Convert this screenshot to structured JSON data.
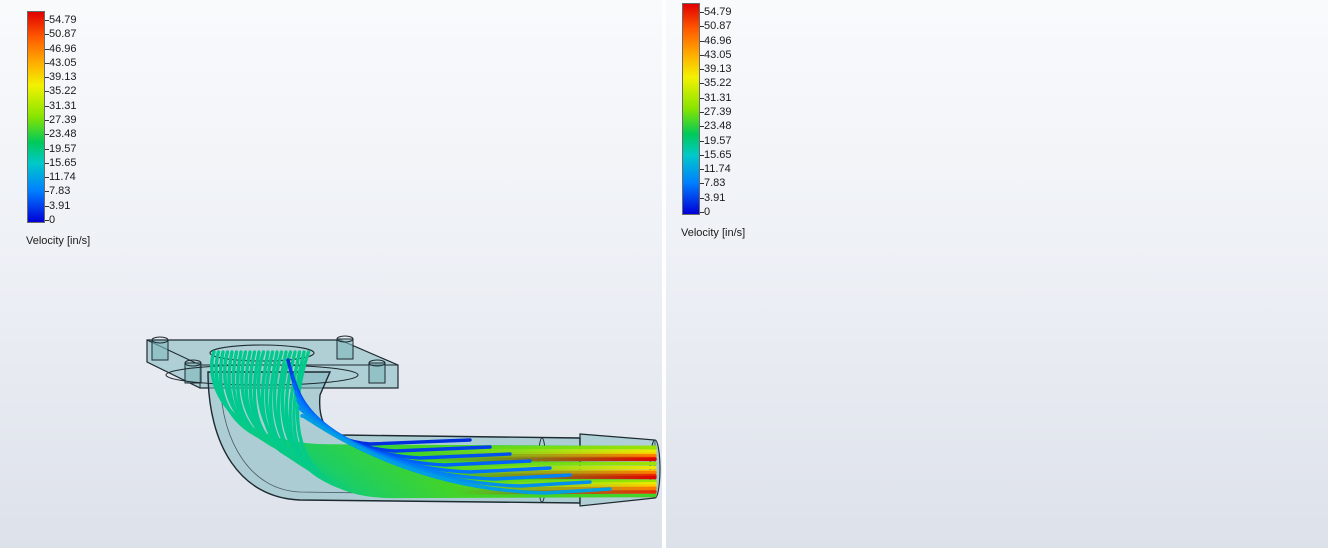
{
  "legend": {
    "ticks": [
      "54.79",
      "50.87",
      "46.96",
      "43.05",
      "39.13",
      "35.22",
      "31.31",
      "27.39",
      "23.48",
      "19.57",
      "15.65",
      "11.74",
      "7.83",
      "3.91",
      "0"
    ],
    "parameter_label": "Velocity [in/s]",
    "min": 0,
    "max": 54.79,
    "colors": [
      "#e00000",
      "#ff6600",
      "#ffcc00",
      "#e8f000",
      "#6fdb00",
      "#00c964",
      "#00c8c8",
      "#0070ff",
      "#0000cc"
    ]
  },
  "left_view": {
    "display_mode": "flow trajectories (lines)"
  },
  "right_view": {
    "display_mode": "flow trajectories (spheres)"
  },
  "colors": {
    "part_fill": "#7fb8bd",
    "part_edge": "#1d2a30",
    "background_top": "#f9fafc",
    "background_bottom": "#dde1ea"
  }
}
